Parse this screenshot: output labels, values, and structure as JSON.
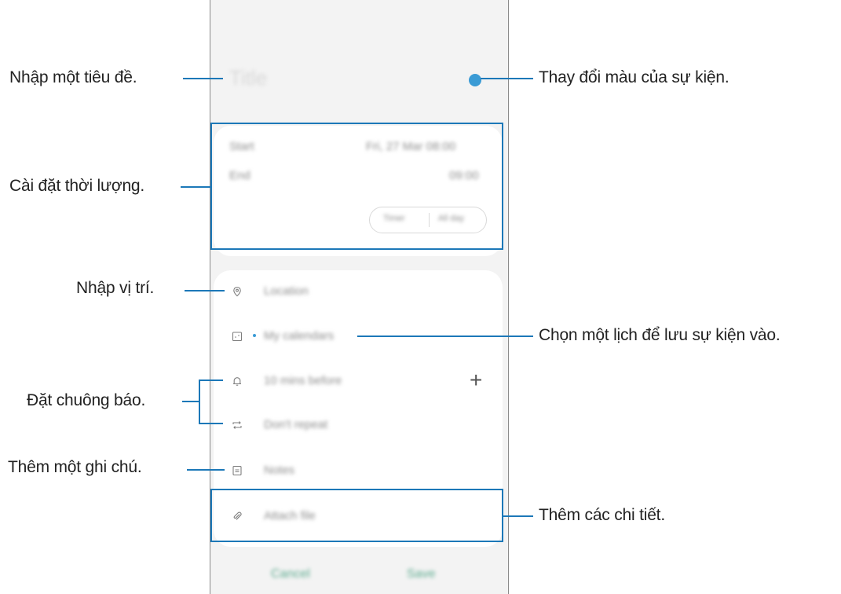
{
  "screen": {
    "title_placeholder": "Title",
    "color_accent": "#3a9bd5",
    "time": {
      "start_label": "Start",
      "start_value": "Fri, 27 Mar  08:00",
      "end_label": "End",
      "end_value": "09:00",
      "timezone_left": "Timer",
      "timezone_right": "All day"
    },
    "details": {
      "location_placeholder": "Location",
      "calendar_value": "My calendars",
      "alarm_value": "10 mins before",
      "repeat_value": "Don't repeat",
      "notes_placeholder": "Notes",
      "attach_label": "Attach file"
    },
    "buttons": {
      "cancel": "Cancel",
      "save": "Save"
    }
  },
  "callouts": {
    "title": "Nhập một tiêu đề.",
    "color": "Thay đổi màu của sự kiện.",
    "duration": "Cài đặt thời lượng.",
    "location": "Nhập vị trí.",
    "calendar": "Chọn một lịch để lưu sự kiện vào.",
    "alarm": "Đặt chuông báo.",
    "notes": "Thêm một ghi chú.",
    "details": "Thêm các chi tiết."
  },
  "highlight_color": "#1c78b8"
}
